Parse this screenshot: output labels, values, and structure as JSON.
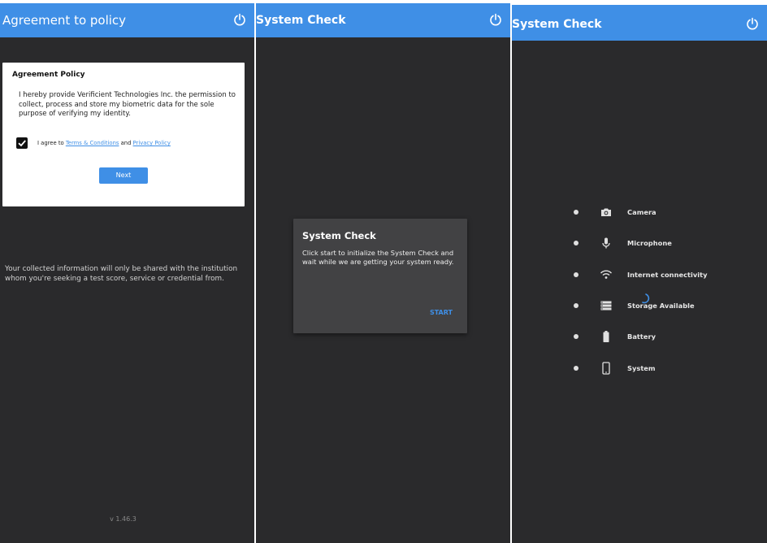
{
  "agreement_screen": {
    "title": "Agreement to policy",
    "card_title": "Agreement Policy",
    "card_body": "I hereby provide Verificient Technologies Inc. the permission to collect, process and store my biometric data for the sole purpose of verifying my identity.",
    "agree_prefix": "I agree to ",
    "terms_link": "Terms & Conditions",
    "and_text": " and ",
    "privacy_link": "Privacy Policy",
    "checked": true,
    "next_label": "Next",
    "info_text": "Your collected information will only be shared with the institution whom you're seeking a test score, service or credential from.",
    "version": "v 1.46.3"
  },
  "system_check_dialog_screen": {
    "title": "System Check",
    "dialog_title": "System Check",
    "dialog_body": "Click start to initialize the System Check and wait while we are getting your system ready.",
    "start_label": "START"
  },
  "system_check_list_screen": {
    "title": "System Check",
    "items": [
      {
        "label": "Camera",
        "icon": "camera-icon"
      },
      {
        "label": "Microphone",
        "icon": "microphone-icon"
      },
      {
        "label": "Internet connectivity",
        "icon": "wifi-icon"
      },
      {
        "label": "Storage Available",
        "icon": "storage-icon"
      },
      {
        "label": "Battery",
        "icon": "battery-icon"
      },
      {
        "label": "System",
        "icon": "phone-icon"
      }
    ]
  },
  "colors": {
    "accent": "#3f8fe6",
    "background": "#2a2a2c",
    "dialog": "#424244"
  }
}
